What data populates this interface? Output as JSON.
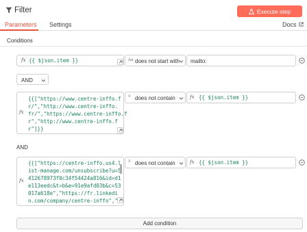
{
  "header": {
    "title": "Filter",
    "execute_label": "Execute step"
  },
  "tabs": {
    "parameters": "Parameters",
    "settings": "Settings",
    "docs": "Docs"
  },
  "conditions_title": "Conditions",
  "combinator_value": "AND",
  "and_label": "AND",
  "conditions": [
    {
      "left": "{{ $json.item }}",
      "operator": "does not start with",
      "operator_icon": "Aa",
      "right": "mailto:"
    },
    {
      "left_lines": [
        "{{[\"https://www.centre-inffo.f",
        "r/\",\"http://www.centre-inffo.",
        "fr/\",\"https://www.centre-inffo.f",
        "r\",\"http://www.centre-inffo.f",
        "r\"]}}"
      ],
      "operator": "does not contain",
      "operator_icon": "≡",
      "right": "{{ $json.item }}"
    },
    {
      "left_lines": [
        "{{[\"https://centre-inffo.us4.l",
        "ist-manage.com/unsubscribe?u=5",
        "412678973f0c34f54424a816&id=d1",
        "e113eedc&t=b&e=91e9afd03b&c=53",
        "017a618e\",\"https://fr.linkedi",
        "n.com/company/centre-inffo\",\"h"
      ],
      "operator": "does not contain",
      "operator_icon": "≡",
      "right": "{{ $json.item }}"
    }
  ],
  "add_condition_label": "Add condition",
  "colors": {
    "accent": "#ff6d5a",
    "tab_active": "#e5533d",
    "expression": "#1a8060"
  }
}
